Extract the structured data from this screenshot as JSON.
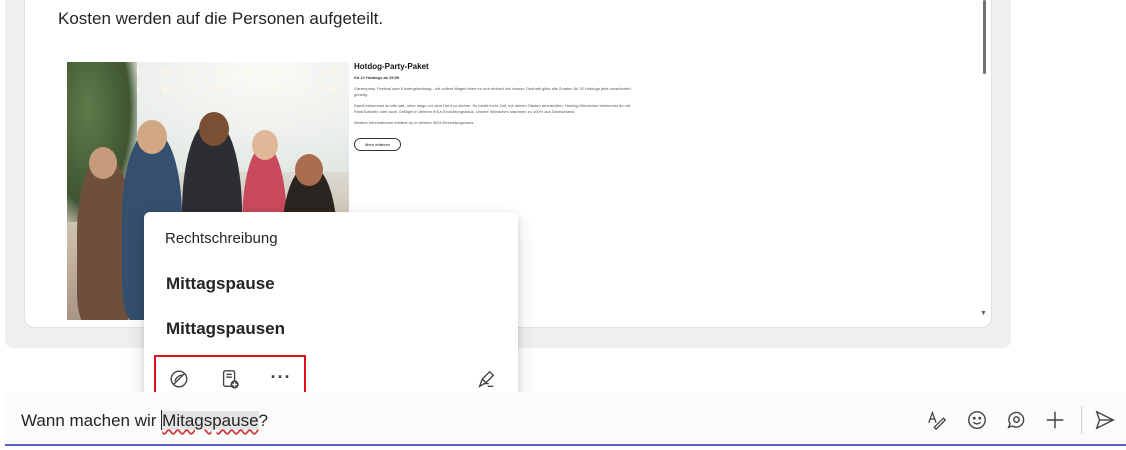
{
  "message": {
    "text": "Kosten werden auf die Personen aufgeteilt.",
    "preview": {
      "title": "Hotdog-Party-Paket",
      "subtitle": "für 12 Hotdogs ab 29,99",
      "paragraph1": "Gartenparty, Festival oder Kindergeburtstag - mit vollem Magen feiert es sich einfach viel besser. Deshalb gibts alle Zutaten für 32 Hotdogs jetzt unverändert günstig.",
      "paragraph2": "Damit bekommst du alle satt, ohne lange vor dem Herd zu stehen. So bleibt mehr Zeit, mit deinen Gästen anzustoßen. Hotdog-Würstchen bekommst du mit Rind/Schwein oder auch Geflügel in deinem IKEA Einrichtungshaus. Unsere Würstchen stammen zu 100% aus Deutschland.",
      "paragraph3": "Weitere Informationen erhältst du in deinem IKEA Einrichtungshaus.",
      "button_label": "Mehr erfahren"
    }
  },
  "spell_popup": {
    "heading": "Rechtschreibung",
    "suggestions": [
      "Mittagspause",
      "Mittagspausen"
    ],
    "actions": [
      {
        "icon": "ignore-icon"
      },
      {
        "icon": "add-to-dictionary-icon"
      },
      {
        "icon": "more-options-icon",
        "label": "···"
      },
      {
        "icon": "editor-pen-icon"
      }
    ],
    "highlight_color": "#e0101a"
  },
  "compose": {
    "text_before": "Wann machen wir ",
    "misspelled_word": "Mitagspause",
    "text_after": "?",
    "tools": [
      "format-icon",
      "emoji-icon",
      "loop-icon",
      "add-icon",
      "send-icon"
    ],
    "accent_color": "#5b5fc7"
  }
}
